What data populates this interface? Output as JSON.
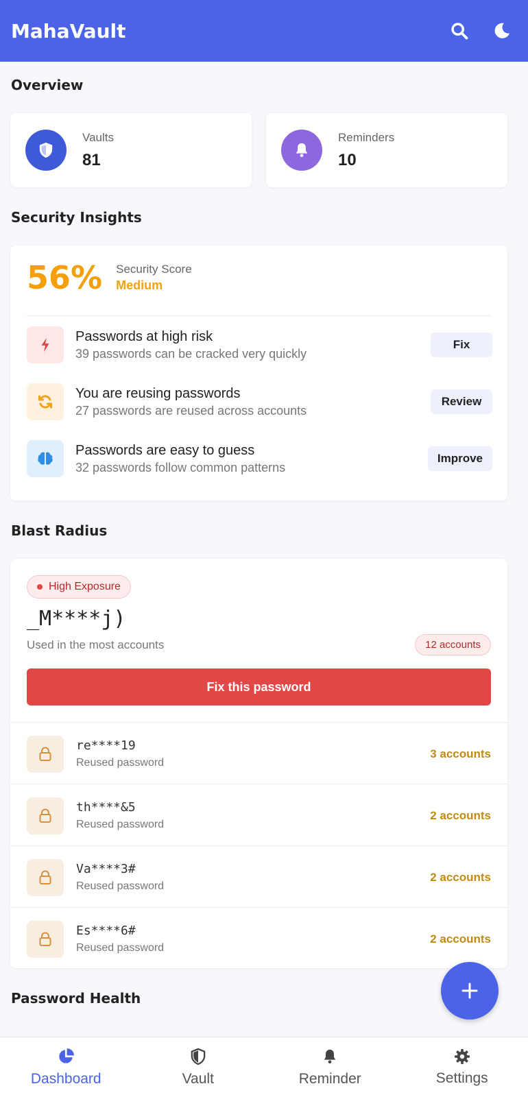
{
  "app": {
    "title": "MahaVault"
  },
  "overview": {
    "title": "Overview",
    "vaults": {
      "label": "Vaults",
      "value": "81"
    },
    "reminders": {
      "label": "Reminders",
      "value": "10"
    }
  },
  "security": {
    "title": "Security Insights",
    "score": "56%",
    "score_label": "Security Score",
    "score_level": "Medium",
    "insights": [
      {
        "title": "Passwords at high risk",
        "subtitle": "39 passwords can be cracked very quickly",
        "action": "Fix",
        "icon": "bolt-icon"
      },
      {
        "title": "You are reusing passwords",
        "subtitle": "27 passwords are reused across accounts",
        "action": "Review",
        "icon": "sync-icon"
      },
      {
        "title": "Passwords are easy to guess",
        "subtitle": "32 passwords follow common patterns",
        "action": "Improve",
        "icon": "brain-icon"
      }
    ]
  },
  "blast": {
    "title": "Blast Radius",
    "exposure": "High Exposure",
    "masked": "_M****j)",
    "used_label": "Used in the most accounts",
    "count": "12 accounts",
    "fix_label": "Fix this password",
    "rows": [
      {
        "masked": "re****19",
        "subtitle": "Reused password",
        "count": "3 accounts"
      },
      {
        "masked": "th****&5",
        "subtitle": "Reused password",
        "count": "2 accounts"
      },
      {
        "masked": "Va****3#",
        "subtitle": "Reused password",
        "count": "2 accounts"
      },
      {
        "masked": "Es****6#",
        "subtitle": "Reused password",
        "count": "2 accounts"
      }
    ]
  },
  "health": {
    "title": "Password Health"
  },
  "nav": {
    "items": [
      {
        "label": "Dashboard",
        "icon": "pie-chart-icon",
        "active": true
      },
      {
        "label": "Vault",
        "icon": "shield-icon"
      },
      {
        "label": "Reminder",
        "icon": "bell-icon"
      },
      {
        "label": "Settings",
        "icon": "gear-icon"
      }
    ]
  },
  "colors": {
    "primary": "#4a63e7",
    "warning": "#f5a00b",
    "danger": "#e04848"
  }
}
